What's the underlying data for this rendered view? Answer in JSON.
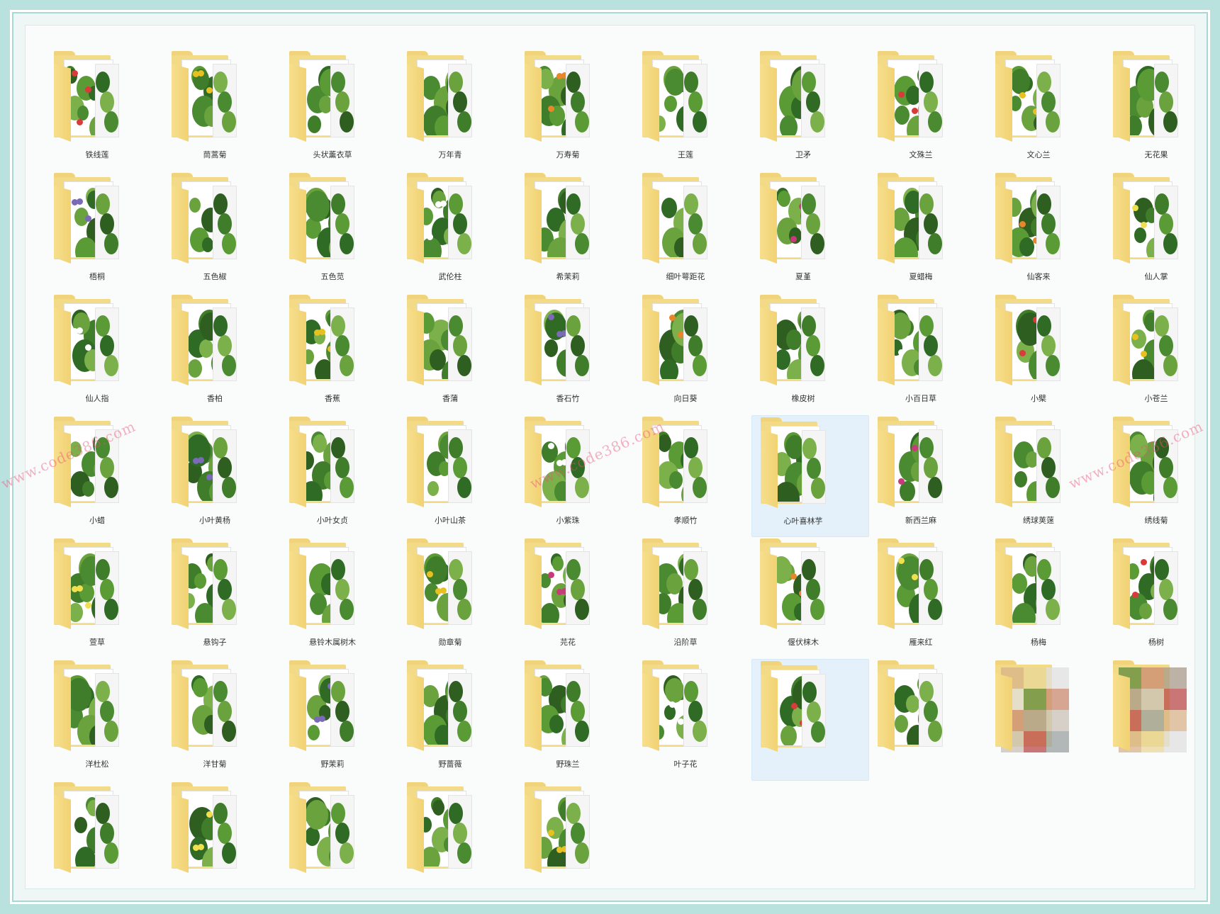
{
  "folders": [
    {
      "label": "铁线莲"
    },
    {
      "label": "茼蒿菊"
    },
    {
      "label": "头状薰衣草"
    },
    {
      "label": "万年青"
    },
    {
      "label": "万寿菊"
    },
    {
      "label": "王莲"
    },
    {
      "label": "卫矛"
    },
    {
      "label": "文殊兰"
    },
    {
      "label": "文心兰"
    },
    {
      "label": "无花果"
    },
    {
      "label": "梧桐"
    },
    {
      "label": "五色椒"
    },
    {
      "label": "五色苋"
    },
    {
      "label": "武伦柱"
    },
    {
      "label": "希茉莉"
    },
    {
      "label": "细叶萼距花"
    },
    {
      "label": "夏堇"
    },
    {
      "label": "夏蜡梅"
    },
    {
      "label": "仙客来"
    },
    {
      "label": "仙人掌"
    },
    {
      "label": "仙人指"
    },
    {
      "label": "香柏"
    },
    {
      "label": "香蕉"
    },
    {
      "label": "香蒲"
    },
    {
      "label": "香石竹"
    },
    {
      "label": "向日葵"
    },
    {
      "label": "橡皮树"
    },
    {
      "label": "小百日草"
    },
    {
      "label": "小檗"
    },
    {
      "label": "小苍兰"
    },
    {
      "label": "小蜡"
    },
    {
      "label": "小叶黄杨"
    },
    {
      "label": "小叶女贞"
    },
    {
      "label": "小叶山茶"
    },
    {
      "label": "小紫珠"
    },
    {
      "label": "孝顺竹"
    },
    {
      "label": "心叶喜林芋"
    },
    {
      "label": "新西兰麻"
    },
    {
      "label": "绣球荚蒾"
    },
    {
      "label": "绣线菊"
    },
    {
      "label": "萱草"
    },
    {
      "label": "悬钩子"
    },
    {
      "label": "悬铃木属树木"
    },
    {
      "label": "勋章菊"
    },
    {
      "label": "芫花"
    },
    {
      "label": "沿阶草"
    },
    {
      "label": "偃伏梾木"
    },
    {
      "label": "雁来红"
    },
    {
      "label": "杨梅"
    },
    {
      "label": "杨树"
    },
    {
      "label": "洋杜松"
    },
    {
      "label": "洋甘菊"
    },
    {
      "label": "野茉莉"
    },
    {
      "label": "野蔷薇"
    },
    {
      "label": "野珠兰"
    },
    {
      "label": "叶子花"
    },
    {
      "label": ""
    },
    {
      "label": ""
    },
    {
      "label": ""
    },
    {
      "label": ""
    },
    {
      "label": ""
    },
    {
      "label": ""
    },
    {
      "label": ""
    },
    {
      "label": ""
    },
    {
      "label": ""
    }
  ],
  "watermark": "www.code386.com",
  "colors": {
    "folder": "#f3da86",
    "selection": "#e4f1fa",
    "background": "#b9e2df"
  }
}
